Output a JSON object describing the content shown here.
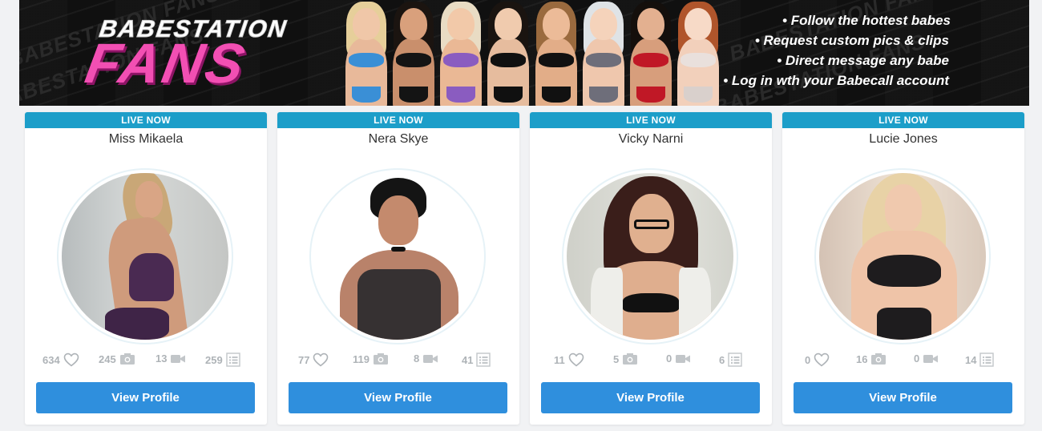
{
  "banner": {
    "logo_top": "BABESTATION",
    "logo_main": "FANS",
    "bg_word": "BABESTATION FANS",
    "bullets": [
      "• Follow the hottest babes",
      "• Request custom pics & clips",
      "• Direct message any babe",
      "• Log in wth your Babecall account"
    ]
  },
  "colors": {
    "live_badge": "#1c9ec9",
    "button": "#2f8fdd",
    "logo_pink": "#f24fb3",
    "stat_gray": "#aeb3b7"
  },
  "cards": [
    {
      "status": "LIVE NOW",
      "name": "Miss Mikaela",
      "stats": {
        "likes": "634",
        "photos": "245",
        "videos": "13",
        "posts": "259"
      },
      "button": "View Profile"
    },
    {
      "status": "LIVE NOW",
      "name": "Nera Skye",
      "stats": {
        "likes": "77",
        "photos": "119",
        "videos": "8",
        "posts": "41"
      },
      "button": "View Profile"
    },
    {
      "status": "LIVE NOW",
      "name": "Vicky Narni",
      "stats": {
        "likes": "11",
        "photos": "5",
        "videos": "0",
        "posts": "6"
      },
      "button": "View Profile"
    },
    {
      "status": "LIVE NOW",
      "name": "Lucie Jones",
      "stats": {
        "likes": "0",
        "photos": "16",
        "videos": "0",
        "posts": "14"
      },
      "button": "View Profile"
    }
  ],
  "icons": {
    "likes": "heart-icon",
    "photos": "camera-icon",
    "videos": "video-camera-icon",
    "posts": "list-icon"
  }
}
